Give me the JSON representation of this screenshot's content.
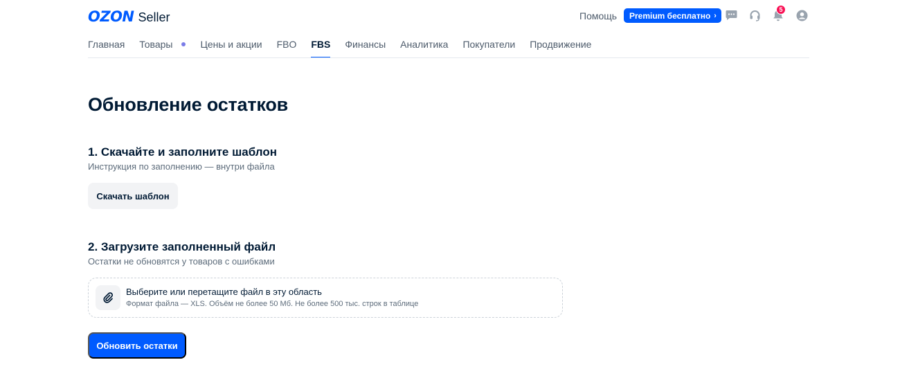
{
  "header": {
    "logo_brand": "OZON",
    "logo_suffix": "Seller",
    "help_label": "Помощь",
    "premium_label": "Premium бесплатно",
    "notifications_count": "5",
    "icons": [
      "chat-icon",
      "support-headset-icon",
      "bell-icon",
      "profile-icon"
    ]
  },
  "nav": {
    "items": [
      {
        "label": "Главная"
      },
      {
        "label": "Товары"
      },
      {
        "label": "Цены и акции"
      },
      {
        "label": "FBO"
      },
      {
        "label": "FBS"
      },
      {
        "label": "Финансы"
      },
      {
        "label": "Аналитика"
      },
      {
        "label": "Покупатели"
      },
      {
        "label": "Продвижение"
      }
    ],
    "active": "FBS"
  },
  "page": {
    "title": "Обновление остатков",
    "step1": {
      "title": "1. Скачайте и заполните шаблон",
      "subtitle": "Инструкция по заполнению — внутри файла",
      "button_label": "Скачать шаблон"
    },
    "step2": {
      "title": "2. Загрузите заполненный файл",
      "subtitle": "Остатки не обновятся у товаров с ошибками",
      "dropzone_title": "Выберите или перетащите файл в эту область",
      "dropzone_hint": "Формат файла — XLS. Объём не более 50 Мб. Не более 500 тыс. строк в таблице"
    },
    "submit_label": "Обновить остатки"
  },
  "colors": {
    "accent": "#005bff",
    "badge": "#f91155",
    "text": "#001a34",
    "muted": "#5d6c7b"
  }
}
